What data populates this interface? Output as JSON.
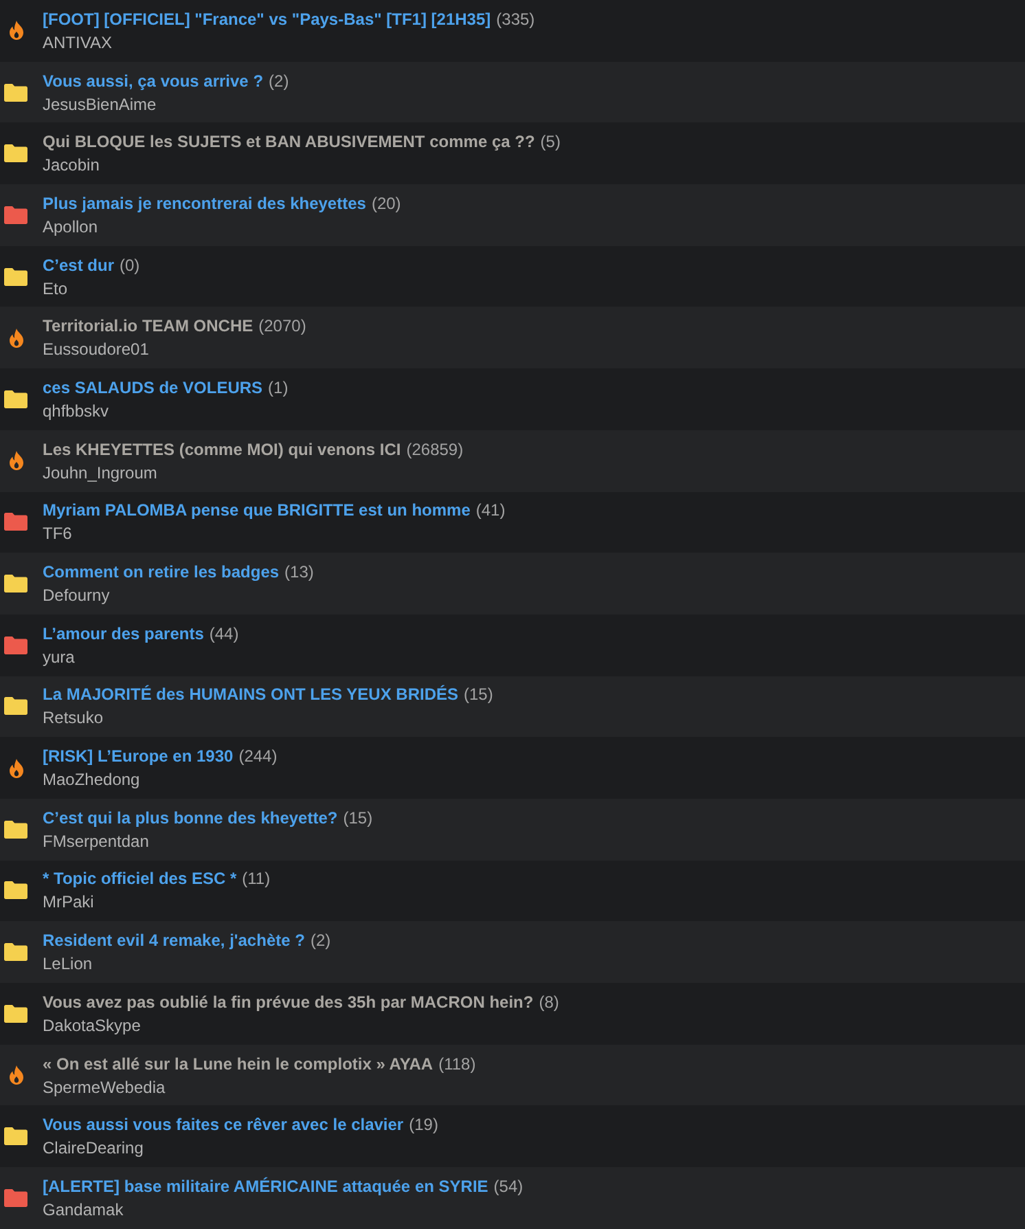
{
  "topics": [
    {
      "kind": "fire",
      "title": "[FOOT] [OFFICIEL] \"France\" vs \"Pays-Bas\" [TF1] [21H35]",
      "count": "(335)",
      "author": "ANTIVAX",
      "visited": false
    },
    {
      "kind": "folder",
      "title": "Vous aussi, ça vous arrive ?",
      "count": "(2)",
      "author": "JesusBienAime",
      "visited": false
    },
    {
      "kind": "folder",
      "title": "Qui BLOQUE les SUJETS et BAN ABUSIVEMENT comme ça ??",
      "count": "(5)",
      "author": "Jacobin",
      "visited": true
    },
    {
      "kind": "red-folder",
      "title": "Plus jamais je rencontrerai des kheyettes",
      "count": "(20)",
      "author": "Apollon",
      "visited": false
    },
    {
      "kind": "folder",
      "title": "C’est dur",
      "count": "(0)",
      "author": "Eto",
      "visited": false
    },
    {
      "kind": "fire",
      "title": "Territorial.io TEAM ONCHE",
      "count": "(2070)",
      "author": "Eussoudore01",
      "visited": true
    },
    {
      "kind": "folder",
      "title": "ces SALAUDS de VOLEURS",
      "count": "(1)",
      "author": "qhfbbskv",
      "visited": false
    },
    {
      "kind": "fire",
      "title": "Les KHEYETTES (comme MOI) qui venons ICI",
      "count": "(26859)",
      "author": "Jouhn_Ingroum",
      "visited": true
    },
    {
      "kind": "red-folder",
      "title": "Myriam PALOMBA pense que BRIGITTE est un homme",
      "count": "(41)",
      "author": "TF6",
      "visited": false
    },
    {
      "kind": "folder",
      "title": "Comment on retire les badges",
      "count": "(13)",
      "author": "Defourny",
      "visited": false
    },
    {
      "kind": "red-folder",
      "title": "L’amour des parents",
      "count": "(44)",
      "author": "yura",
      "visited": false
    },
    {
      "kind": "folder",
      "title": "La MAJORITÉ des HUMAINS ONT LES YEUX BRIDÉS",
      "count": "(15)",
      "author": "Retsuko",
      "visited": false
    },
    {
      "kind": "fire",
      "title": "[RISK] L’Europe en 1930",
      "count": "(244)",
      "author": "MaoZhedong",
      "visited": false
    },
    {
      "kind": "folder",
      "title": "C’est qui la plus bonne des kheyette?",
      "count": "(15)",
      "author": "FMserpentdan",
      "visited": false
    },
    {
      "kind": "folder",
      "title": "* Topic officiel des ESC *",
      "count": "(11)",
      "author": "MrPaki",
      "visited": false
    },
    {
      "kind": "folder",
      "title": "Resident evil 4 remake, j'achète ?",
      "count": "(2)",
      "author": "LeLion",
      "visited": false
    },
    {
      "kind": "folder",
      "title": "Vous avez pas oublié la fin prévue des 35h par MACRON hein?",
      "count": "(8)",
      "author": "DakotaSkype",
      "visited": true
    },
    {
      "kind": "fire",
      "title": "« On est allé sur la Lune hein le complotix » AYAA",
      "count": "(118)",
      "author": "SpermeWebedia",
      "visited": true
    },
    {
      "kind": "folder",
      "title": "Vous aussi vous faites ce rêver avec le clavier",
      "count": "(19)",
      "author": "ClaireDearing",
      "visited": false
    },
    {
      "kind": "red-folder",
      "title": "[ALERTE] base militaire AMÉRICAINE attaquée en SYRIE",
      "count": "(54)",
      "author": "Gandamak",
      "visited": false
    }
  ]
}
